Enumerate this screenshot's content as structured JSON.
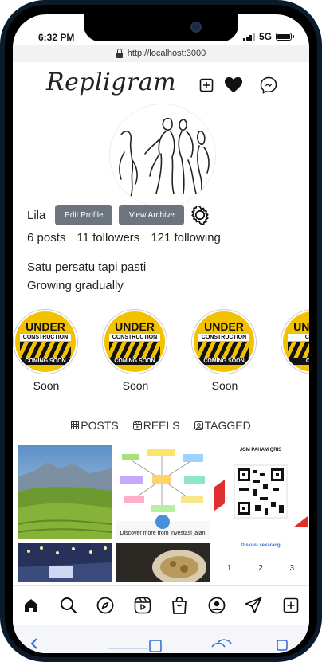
{
  "status": {
    "time": "6:32 PM",
    "network": "5G"
  },
  "browser": {
    "url": "http://localhost:3000"
  },
  "app": {
    "logo": "Repligram"
  },
  "header": {
    "icons": [
      "add-post-icon",
      "heart-icon",
      "messenger-icon"
    ]
  },
  "profile": {
    "username": "Lila",
    "edit_label": "Edit Profile",
    "archive_label": "View Archive",
    "posts": "6 posts",
    "followers": "11 followers",
    "following": "121 following",
    "bio_line1": "Satu persatu tapi pasti",
    "bio_line2": "Growing gradually"
  },
  "highlights": [
    {
      "label": "Soon",
      "top": "UNDER",
      "mid": "CONSTRUCTION",
      "bottom": "COMING SOON"
    },
    {
      "label": "Soon",
      "top": "UNDER",
      "mid": "CONSTRUCTION",
      "bottom": "COMING SOON"
    },
    {
      "label": "Soon",
      "top": "UNDER",
      "mid": "CONSTRUCTION",
      "bottom": "COMING SOON"
    },
    {
      "label": "",
      "top": "UNDER",
      "mid": "CONS",
      "bottom": "COMI"
    }
  ],
  "tabs": {
    "posts": "POSTS",
    "reels": "REELS",
    "tagged": "TAGGED"
  },
  "posts": {
    "p2_caption": "Discover more from investasi jalan",
    "p3_title": "JOM PAHAM QRIS",
    "p3_link": "Diskusi sekarang",
    "p3_pages": [
      "1",
      "2",
      "3"
    ]
  },
  "bottom_nav": [
    "home-icon",
    "search-icon",
    "explore-icon",
    "reels-icon",
    "shop-icon",
    "profile-icon",
    "send-icon",
    "create-icon"
  ],
  "colors": {
    "button_gray": "#6c757d",
    "accent_yellow": "#f2c200"
  }
}
